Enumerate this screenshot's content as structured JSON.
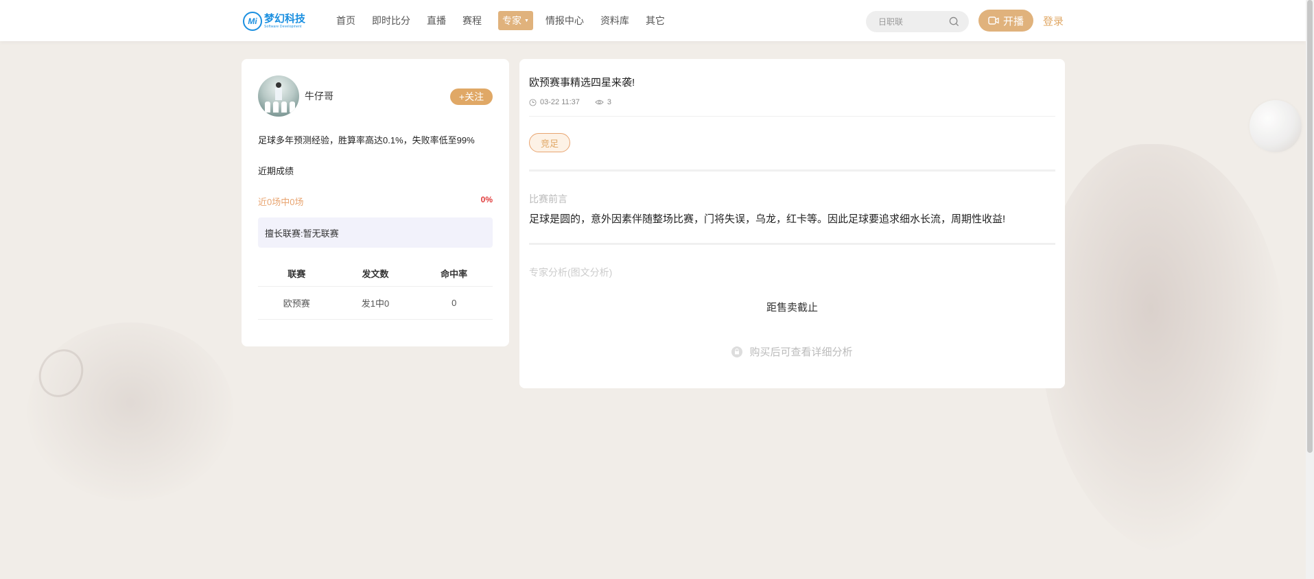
{
  "header": {
    "logo_name": "梦幻科技",
    "logo_sub": "Software Development",
    "nav": [
      {
        "label": "首页"
      },
      {
        "label": "即时比分"
      },
      {
        "label": "直播"
      },
      {
        "label": "赛程"
      },
      {
        "label": "专家",
        "active": true
      },
      {
        "label": "情报中心"
      },
      {
        "label": "资料库"
      },
      {
        "label": "其它"
      }
    ],
    "search_placeholder": "日职联",
    "live_label": "开播",
    "login_label": "登录"
  },
  "expert": {
    "name": "牛仔哥",
    "follow_label": "+关注",
    "bio": "足球多年预测经验，胜算率高达0.1%，失败率低至99%",
    "recent_title": "近期成绩",
    "record": "近0场中0场",
    "rate": "0%",
    "specialty": "擅长联赛:暂无联赛",
    "table": {
      "headers": [
        "联赛",
        "发文数",
        "命中率"
      ],
      "rows": [
        [
          "欧预赛",
          "发1中0",
          "0"
        ]
      ]
    }
  },
  "article": {
    "title": "欧预赛事精选四星来袭!",
    "time": "03-22 11:37",
    "views": "3",
    "tag": "竞足",
    "preview_label": "比赛前言",
    "preview_text": "足球是圆的，意外因素伴随整场比赛，门将失误，乌龙，红卡等。因此足球要追求细水长流，周期性收益!",
    "analysis_label": "专家分析(图文分析)",
    "deadline": "距售卖截止",
    "locked_text": "购买后可查看详细分析"
  },
  "colors": {
    "accent": "#e0b27c",
    "brand_blue": "#1a8fe0",
    "rate_red": "#e03a3a"
  }
}
